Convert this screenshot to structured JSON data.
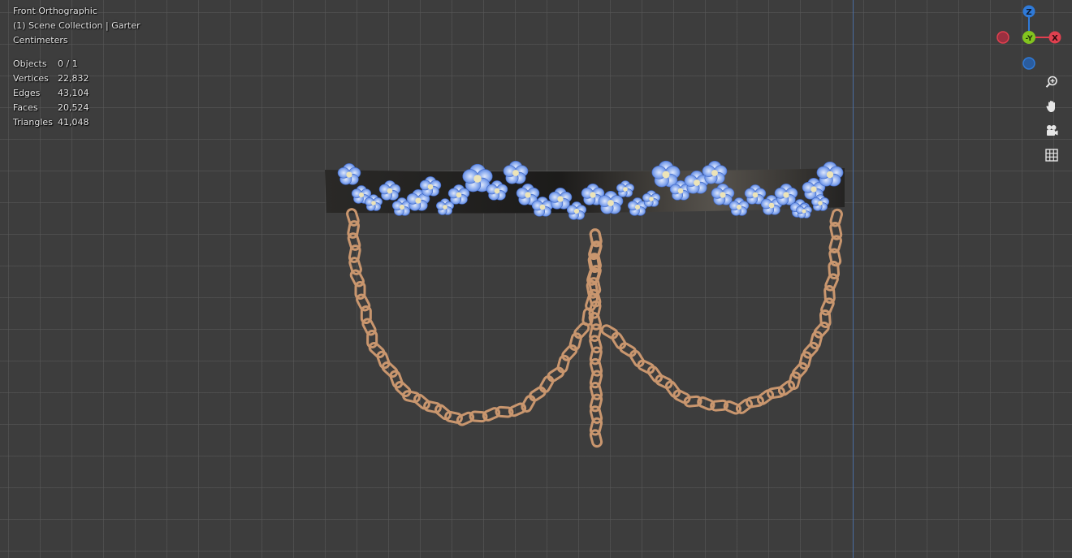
{
  "viewport": {
    "view_name": "Front Orthographic",
    "collection": "(1) Scene Collection | Garter",
    "units": "Centimeters"
  },
  "stats": [
    {
      "label": "Objects",
      "value": "0 / 1"
    },
    {
      "label": "Vertices",
      "value": "22,832"
    },
    {
      "label": "Edges",
      "value": "43,104"
    },
    {
      "label": "Faces",
      "value": "20,524"
    },
    {
      "label": "Triangles",
      "value": "41,048"
    }
  ],
  "gizmo": {
    "z_label": "Z",
    "y_label": "-Y",
    "x_label": "X",
    "colors": {
      "x": "#e0404f",
      "y": "#82c41f",
      "z": "#2f7ad8",
      "x_neg": "#9a3040",
      "z_neg": "#2a5c9e"
    }
  },
  "nav_icons": [
    "zoom-icon",
    "hand-pan-icon",
    "camera-icon",
    "grid-perspective-icon"
  ],
  "colors": {
    "background": "#3d3d3d",
    "grid": "#5a5a5a",
    "z_axis": "#4a6da1",
    "band": "#1e1d1c",
    "flower": "#6f93e4",
    "flower_center": "#ede4b8",
    "chain": "#c9966e"
  }
}
